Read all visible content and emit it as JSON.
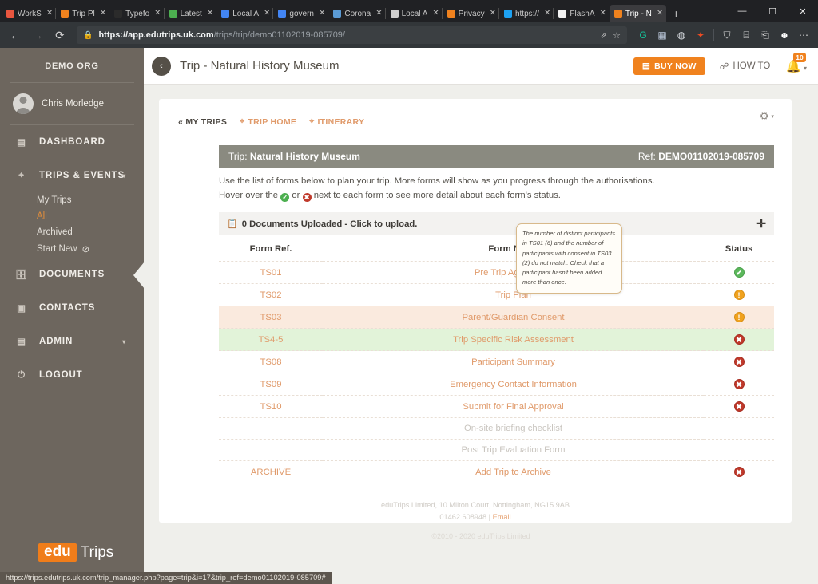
{
  "browser": {
    "tabs": [
      {
        "title": "WorkS",
        "favicon": "#e8563f",
        "active": false
      },
      {
        "title": "Trip Pl",
        "favicon": "#f0821e",
        "active": false
      },
      {
        "title": "Typefo",
        "favicon": "#2b2b2b",
        "active": false
      },
      {
        "title": "Latest",
        "favicon": "#4caf50",
        "active": false
      },
      {
        "title": "Local A",
        "favicon": "#4285f4",
        "active": false
      },
      {
        "title": "govern",
        "favicon": "#4285f4",
        "active": false
      },
      {
        "title": "Corona",
        "favicon": "#5b9bd5",
        "active": false
      },
      {
        "title": "Local A",
        "favicon": "#cfcfcf",
        "active": false
      },
      {
        "title": "Privacy",
        "favicon": "#f0821e",
        "active": false
      },
      {
        "title": "https://",
        "favicon": "#1da1f2",
        "active": false
      },
      {
        "title": "FlashA",
        "favicon": "#f2f2f2",
        "active": false
      },
      {
        "title": "Trip - N",
        "favicon": "#f0821e",
        "active": true
      }
    ],
    "new_tab_label": "+",
    "close_glyph": "✕",
    "window_controls": {
      "minimize": "—",
      "maximize": "☐",
      "close": "✕"
    },
    "nav": {
      "back": "←",
      "forward": "→",
      "reload": "⟳"
    },
    "omnibox": {
      "lock_icon": "🔒",
      "url_bold": "https://app.edutrips.uk.com",
      "url_rest": "/trips/trip/demo01102019-085709/",
      "share_icon": "⇗",
      "favorite_icon": "☆"
    },
    "toolbar_icons": [
      {
        "name": "grammarly-extension-icon",
        "glyph": "G",
        "color": "#15c39a"
      },
      {
        "name": "screenshot-extension-icon",
        "glyph": "▦",
        "color": "#b7c4d6"
      },
      {
        "name": "pocket-extension-icon",
        "glyph": "◍",
        "color": "#dfe3e8"
      },
      {
        "name": "adobe-extension-icon",
        "glyph": "✦",
        "color": "#ee4b22"
      },
      {
        "name": "collections-icon",
        "glyph": "⛉",
        "color": "#d6d6d6"
      },
      {
        "name": "browser-essentials-icon",
        "glyph": "⌸",
        "color": "#d6d6d6"
      },
      {
        "name": "share-feedback-icon",
        "glyph": "⎗",
        "color": "#d6d6d6"
      },
      {
        "name": "profile-icon",
        "glyph": "☻",
        "color": "#ffffff"
      },
      {
        "name": "settings-more-icon",
        "glyph": "⋯",
        "color": "#d6d6d6"
      }
    ]
  },
  "sidebar": {
    "org_name": "DEMO ORG",
    "user_name": "Chris Morledge",
    "items": [
      {
        "label": "DASHBOARD",
        "icon": "dashboard-icon",
        "glyph": "▤",
        "caret": ""
      },
      {
        "label": "TRIPS & EVENTS",
        "icon": "location-pin-icon",
        "glyph": "⌖",
        "caret": "▾"
      },
      {
        "label": "DOCUMENTS",
        "icon": "documents-icon",
        "glyph": "🗄",
        "caret": ""
      },
      {
        "label": "CONTACTS",
        "icon": "contacts-card-icon",
        "glyph": "▣",
        "caret": ""
      },
      {
        "label": "ADMIN",
        "icon": "admin-book-icon",
        "glyph": "▤",
        "caret": "▾"
      },
      {
        "label": "LOGOUT",
        "icon": "power-icon",
        "glyph": "⏻",
        "caret": ""
      }
    ],
    "sub_items": [
      {
        "label": "My Trips",
        "active": false,
        "suffix": ""
      },
      {
        "label": "All",
        "active": true,
        "suffix": ""
      },
      {
        "label": "Archived",
        "active": false,
        "suffix": ""
      },
      {
        "label": "Start New",
        "active": false,
        "suffix": "⊘"
      }
    ],
    "brand": {
      "edu": "edu",
      "trips": "Trips"
    }
  },
  "topbar": {
    "back_glyph": "‹",
    "title": "Trip - Natural History Museum",
    "buy_now_label": "BUY NOW",
    "buy_now_icon": "▤",
    "how_to_label": "HOW TO",
    "how_to_icon": "☍",
    "notification_count": "10",
    "bell_icon": "🔔",
    "caret": "▾"
  },
  "card": {
    "nav": [
      {
        "label": "« MY TRIPS",
        "style": "dark",
        "icon": ""
      },
      {
        "label": "TRIP HOME",
        "style": "orange",
        "icon": "⌖"
      },
      {
        "label": "ITINERARY",
        "style": "orange",
        "icon": "⌖"
      }
    ],
    "gear_icon": "⚙",
    "gear_caret": "▾",
    "trip_band": {
      "label": "Trip:",
      "trip_name": "Natural History Museum",
      "ref_label": "Ref:",
      "ref_value": "DEMO01102019-085709"
    },
    "intro_line1": "Use the list of forms below to plan your trip. More forms will show as you progress through the authorisations.",
    "intro_line2_a": "Hover over the",
    "intro_line2_b": "or",
    "intro_line2_c": "next to each form to see more detail about each form's status.",
    "documents_bar": {
      "icon": "📋",
      "label": "0 Documents Uploaded - Click to upload.",
      "plus": "✛"
    },
    "table": {
      "headers": [
        "Form Ref.",
        "Form Name",
        "Status"
      ],
      "rows": [
        {
          "ref": "TS01",
          "name": "Pre Trip Agreement",
          "status": "ok",
          "status_glyph": "✔",
          "highlight": "none",
          "muted": false
        },
        {
          "ref": "TS02",
          "name": "Trip Plan",
          "status": "warn",
          "status_glyph": "!",
          "highlight": "none",
          "muted": false
        },
        {
          "ref": "TS03",
          "name": "Parent/Guardian Consent",
          "status": "warn",
          "status_glyph": "!",
          "highlight": "peach",
          "muted": false
        },
        {
          "ref": "TS4-5",
          "name": "Trip Specific Risk Assessment",
          "status": "err",
          "status_glyph": "✖",
          "highlight": "green",
          "muted": false
        },
        {
          "ref": "TS08",
          "name": "Participant Summary",
          "status": "err",
          "status_glyph": "✖",
          "highlight": "none",
          "muted": false
        },
        {
          "ref": "TS09",
          "name": "Emergency Contact Information",
          "status": "err",
          "status_glyph": "✖",
          "highlight": "none",
          "muted": false
        },
        {
          "ref": "TS10",
          "name": "Submit for Final Approval",
          "status": "err",
          "status_glyph": "✖",
          "highlight": "none",
          "muted": false
        },
        {
          "ref": "",
          "name": "On-site briefing checklist",
          "status": "",
          "status_glyph": "",
          "highlight": "none",
          "muted": true
        },
        {
          "ref": "",
          "name": "Post Trip Evaluation Form",
          "status": "",
          "status_glyph": "",
          "highlight": "none",
          "muted": true
        },
        {
          "ref": "ARCHIVE",
          "name": "Add Trip to Archive",
          "status": "err",
          "status_glyph": "✖",
          "highlight": "none",
          "muted": false
        }
      ]
    },
    "tooltip": "The number of distinct participants in TS01 (6) and the number of participants with consent in TS03 (2) do not match. Check that a participant hasn't been added more than once.",
    "footer_line1": "eduTrips Limited, 10 Milton Court, Nottingham, NG15 9AB",
    "footer_phone": "01462 608948 |",
    "footer_email": "Email",
    "copyright": "©2010 - 2020 eduTrips Limited"
  },
  "status_bar": {
    "url": "https://trips.edutrips.uk.com/trip_manager.php?page=trip&i=17&trip_ref=demo01102019-085709#"
  },
  "colors": {
    "brand_orange": "#f0821e",
    "sidebar_brown": "#6d665e",
    "band_grey": "#8a8a80",
    "link_peach": "#e09a6a",
    "status_ok": "#5cb85c",
    "status_warn": "#f0a21e",
    "status_err": "#c0392b"
  }
}
